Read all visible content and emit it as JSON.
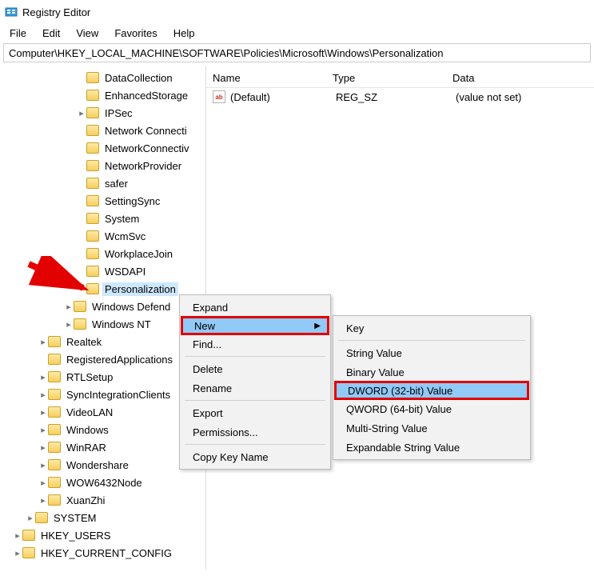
{
  "title": "Registry Editor",
  "menu": {
    "file": "File",
    "edit": "Edit",
    "view": "View",
    "favorites": "Favorites",
    "help": "Help"
  },
  "address": "Computer\\HKEY_LOCAL_MACHINE\\SOFTWARE\\Policies\\Microsoft\\Windows\\Personalization",
  "tree": [
    {
      "indent": 6,
      "chev": "none",
      "label": "DataCollection"
    },
    {
      "indent": 6,
      "chev": "none",
      "label": "EnhancedStorage"
    },
    {
      "indent": 6,
      "chev": "closed",
      "label": "IPSec"
    },
    {
      "indent": 6,
      "chev": "none",
      "label": "Network Connecti"
    },
    {
      "indent": 6,
      "chev": "none",
      "label": "NetworkConnectiv"
    },
    {
      "indent": 6,
      "chev": "none",
      "label": "NetworkProvider"
    },
    {
      "indent": 6,
      "chev": "none",
      "label": "safer"
    },
    {
      "indent": 6,
      "chev": "none",
      "label": "SettingSync"
    },
    {
      "indent": 6,
      "chev": "none",
      "label": "System"
    },
    {
      "indent": 6,
      "chev": "none",
      "label": "WcmSvc"
    },
    {
      "indent": 6,
      "chev": "none",
      "label": "WorkplaceJoin"
    },
    {
      "indent": 6,
      "chev": "none",
      "label": "WSDAPI"
    },
    {
      "indent": 6,
      "chev": "none",
      "label": "Personalization",
      "selected": true
    },
    {
      "indent": 5,
      "chev": "closed",
      "label": "Windows Defend"
    },
    {
      "indent": 5,
      "chev": "closed",
      "label": "Windows NT"
    },
    {
      "indent": 3,
      "chev": "closed",
      "label": "Realtek"
    },
    {
      "indent": 3,
      "chev": "none",
      "label": "RegisteredApplications"
    },
    {
      "indent": 3,
      "chev": "closed",
      "label": "RTLSetup"
    },
    {
      "indent": 3,
      "chev": "closed",
      "label": "SyncIntegrationClients"
    },
    {
      "indent": 3,
      "chev": "closed",
      "label": "VideoLAN"
    },
    {
      "indent": 3,
      "chev": "closed",
      "label": "Windows"
    },
    {
      "indent": 3,
      "chev": "closed",
      "label": "WinRAR"
    },
    {
      "indent": 3,
      "chev": "closed",
      "label": "Wondershare"
    },
    {
      "indent": 3,
      "chev": "closed",
      "label": "WOW6432Node"
    },
    {
      "indent": 3,
      "chev": "closed",
      "label": "XuanZhi"
    },
    {
      "indent": 2,
      "chev": "closed",
      "label": "SYSTEM"
    },
    {
      "indent": 1,
      "chev": "closed",
      "label": "HKEY_USERS"
    },
    {
      "indent": 1,
      "chev": "closed",
      "label": "HKEY_CURRENT_CONFIG"
    }
  ],
  "columns": {
    "name": "Name",
    "type": "Type",
    "data": "Data"
  },
  "rows": [
    {
      "name": "(Default)",
      "type": "REG_SZ",
      "data": "(value not set)"
    }
  ],
  "ctx1": {
    "expand": "Expand",
    "new": "New",
    "find": "Find...",
    "delete": "Delete",
    "rename": "Rename",
    "export": "Export",
    "permissions": "Permissions...",
    "copy": "Copy Key Name"
  },
  "ctx2": {
    "key": "Key",
    "string": "String Value",
    "binary": "Binary Value",
    "dword": "DWORD (32-bit) Value",
    "qword": "QWORD (64-bit) Value",
    "multi": "Multi-String Value",
    "expand": "Expandable String Value"
  }
}
